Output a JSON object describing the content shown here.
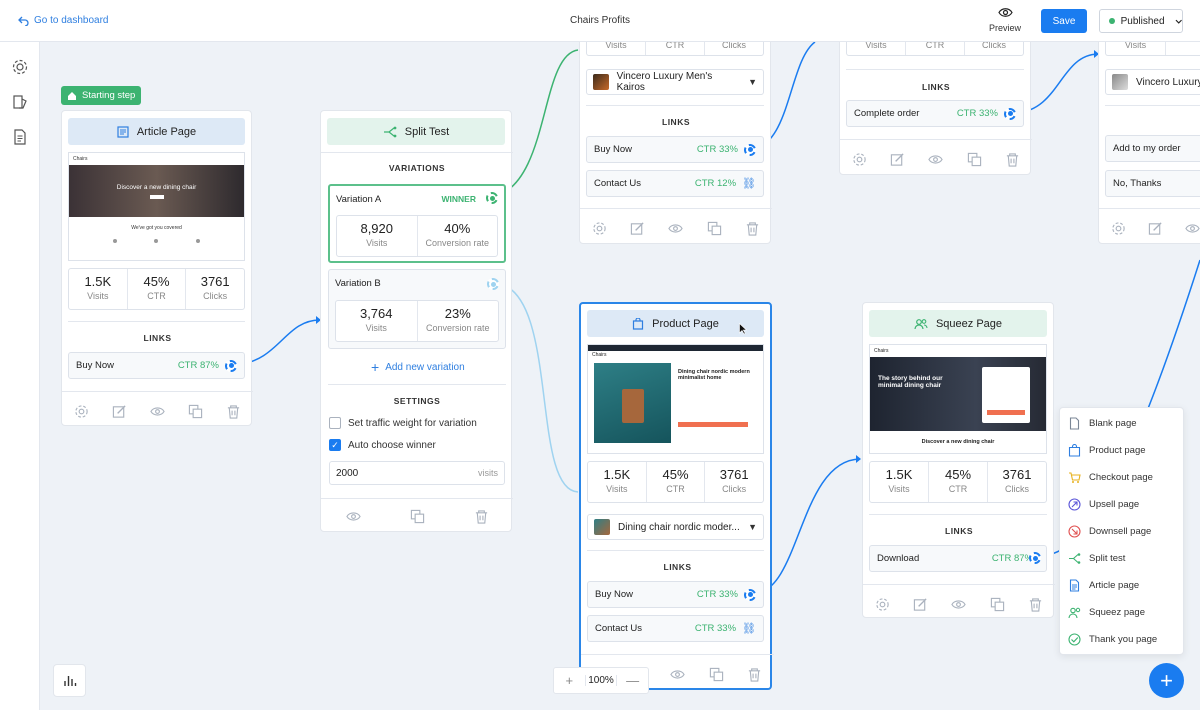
{
  "topbar": {
    "back_label": "Go to dashboard",
    "title": "Chairs Profits",
    "preview_label": "Preview",
    "save_label": "Save",
    "status_label": "Published",
    "status_color": "#3cb371",
    "accent": "#1a7cf0"
  },
  "start_badge": "Starting step",
  "article": {
    "title": "Article Page",
    "thumb_hero": "Discover a new dining chair",
    "thumb_sub": "We've got you covered",
    "thumb_brand": "Chairs",
    "stats": [
      {
        "value": "1.5K",
        "label": "Visits"
      },
      {
        "value": "45%",
        "label": "CTR"
      },
      {
        "value": "3761",
        "label": "Clicks"
      }
    ],
    "links_title": "LINKS",
    "links": [
      {
        "label": "Buy Now",
        "ctr": "CTR 87%"
      }
    ]
  },
  "split": {
    "title": "Split Test",
    "variations_title": "VARIATIONS",
    "variations": [
      {
        "name": "Variation A",
        "badge": "WINNER",
        "visits": "8,920",
        "visits_label": "Visits",
        "rate": "40%",
        "rate_label": "Conversion rate"
      },
      {
        "name": "Variation B",
        "visits": "3,764",
        "visits_label": "Visits",
        "rate": "23%",
        "rate_label": "Conversion rate"
      }
    ],
    "add_variation": "Add new variation",
    "settings_title": "SETTINGS",
    "setting_weight": "Set traffic weight for variation",
    "setting_auto": "Auto choose winner",
    "visits_value": "2000",
    "visits_unit": "visits"
  },
  "card_top": {
    "stats": [
      {
        "label": "Visits"
      },
      {
        "label": "CTR"
      },
      {
        "label": "Clicks"
      }
    ],
    "product": "Vincero Luxury Men's Kairos",
    "links_title": "LINKS",
    "links": [
      {
        "label": "Buy Now",
        "ctr": "CTR 33%"
      },
      {
        "label": "Contact Us",
        "ctr": "CTR 12%"
      }
    ]
  },
  "card_order": {
    "stats": [
      {
        "label": "Visits"
      },
      {
        "label": "CTR"
      },
      {
        "label": "Clicks"
      }
    ],
    "links_title": "LINKS",
    "links": [
      {
        "label": "Complete order",
        "ctr": "CTR 33%"
      }
    ]
  },
  "card_far": {
    "stats": [
      {
        "label": "Visits"
      }
    ],
    "product": "Vincero Luxury",
    "links": [
      {
        "label": "Add to my order"
      },
      {
        "label": "No, Thanks"
      }
    ]
  },
  "product": {
    "title": "Product Page",
    "thumb_title": "Dining chair nordic modern minimalist home",
    "thumb_brand": "Chairs",
    "stats": [
      {
        "value": "1.5K",
        "label": "Visits"
      },
      {
        "value": "45%",
        "label": "CTR"
      },
      {
        "value": "3761",
        "label": "Clicks"
      }
    ],
    "selected_product": "Dining chair nordic moder...",
    "links_title": "LINKS",
    "links": [
      {
        "label": "Buy Now",
        "ctr": "CTR 33%"
      },
      {
        "label": "Contact Us",
        "ctr": "CTR 33%"
      }
    ]
  },
  "squeeze": {
    "title": "Squeez Page",
    "thumb_hero": "The story behind our minimal dining chair",
    "thumb_sub": "Discover a new dining chair",
    "thumb_brand": "Chairs",
    "stats": [
      {
        "value": "1.5K",
        "label": "Visits"
      },
      {
        "value": "45%",
        "label": "CTR"
      },
      {
        "value": "3761",
        "label": "Clicks"
      }
    ],
    "links_title": "LINKS",
    "links": [
      {
        "label": "Download",
        "ctr": "CTR 87%"
      }
    ]
  },
  "menu": {
    "items": [
      {
        "label": "Blank page",
        "icon": "blank-page-icon"
      },
      {
        "label": "Product page",
        "icon": "product-page-icon"
      },
      {
        "label": "Checkout page",
        "icon": "cart-icon"
      },
      {
        "label": "Upsell page",
        "icon": "upsell-icon"
      },
      {
        "label": "Downsell page",
        "icon": "downsell-icon"
      },
      {
        "label": "Split test",
        "icon": "split-icon"
      },
      {
        "label": "Article page",
        "icon": "article-icon"
      },
      {
        "label": "Squeez page",
        "icon": "users-icon"
      },
      {
        "label": "Thank you page",
        "icon": "check-icon"
      }
    ]
  },
  "zoom": {
    "level": "100%",
    "plus": "+",
    "minus": "—"
  },
  "fab_label": "+"
}
